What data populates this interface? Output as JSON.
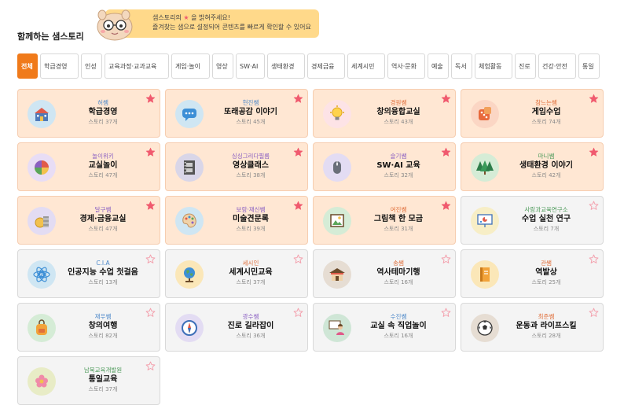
{
  "header": {
    "title": "함께하는 샘스토리",
    "notice_line1_a": "샘스토리의",
    "notice_line1_b": "을 밝혀주세요!",
    "notice_line2": "즐겨찾는 샘으로 설정되어 콘텐츠를 빠르게 확인할 수 있어요"
  },
  "filters": [
    {
      "label": "전체",
      "active": true,
      "w": 26
    },
    {
      "label": "학급경영",
      "w": 49
    },
    {
      "label": "인성",
      "w": 27
    },
    {
      "label": "교육과정·교과교육",
      "w": 82
    },
    {
      "label": "게임·놀이",
      "w": 49
    },
    {
      "label": "영상",
      "w": 27
    },
    {
      "label": "SW·AI",
      "w": 37
    },
    {
      "label": "생태환경",
      "w": 48
    },
    {
      "label": "경제금융",
      "w": 48
    },
    {
      "label": "세계시민",
      "w": 48
    },
    {
      "label": "역사·문화",
      "w": 48
    },
    {
      "label": "예술",
      "w": 27
    },
    {
      "label": "독서",
      "w": 27
    },
    {
      "label": "체험활동",
      "w": 48
    },
    {
      "label": "진로",
      "w": 27
    },
    {
      "label": "건강·안전",
      "w": 48
    },
    {
      "label": "통일",
      "w": 27
    }
  ],
  "colors": {
    "accent": "#f07a1a",
    "card_highlight": "#ffe7d3",
    "card_default": "#f4f4f4",
    "star_filled": "#f05a6e",
    "teacher_orange": "#e0703c",
    "teacher_blue": "#4d88c9",
    "teacher_green": "#4d9a5a"
  },
  "cards": [
    {
      "teacher": "허쌤",
      "title": "학급경영",
      "count": "스토리 37개",
      "hl": true,
      "fav": true,
      "tc": "#4d88c9",
      "bg": "#cfe6f3",
      "icon": "school-icon"
    },
    {
      "teacher": "현진쌤",
      "title": "또래공감 이야기",
      "count": "스토리 45개",
      "hl": true,
      "fav": true,
      "tc": "#4d88c9",
      "bg": "#cfe6f3",
      "icon": "chat-icon"
    },
    {
      "teacher": "경원쌤",
      "title": "창의융합교실",
      "count": "스토리 43개",
      "hl": true,
      "fav": true,
      "tc": "#e0703c",
      "bg": "#fde3e6",
      "icon": "lightbulb-icon"
    },
    {
      "teacher": "참느는쌤",
      "title": "게임수업",
      "count": "스토리 74개",
      "hl": true,
      "fav": true,
      "tc": "#e0703c",
      "bg": "#fbd6c4",
      "icon": "dice-icon"
    },
    {
      "teacher": "놀이위키",
      "title": "교실놀이",
      "count": "스토리 47개",
      "hl": true,
      "fav": true,
      "tc": "#8a5fc2",
      "bg": "#e8ddf5",
      "icon": "ball-icon"
    },
    {
      "teacher": "싱싱그리다필름",
      "title": "영상클래스",
      "count": "스토리 38개",
      "hl": true,
      "fav": true,
      "tc": "#8a5fc2",
      "bg": "#d9d6e8",
      "icon": "film-icon"
    },
    {
      "teacher": "슬기쌤",
      "title": "SW·AI 교육",
      "count": "스토리 32개",
      "hl": true,
      "fav": true,
      "tc": "#8a5fc2",
      "bg": "#e3dcf3",
      "icon": "mouse-icon"
    },
    {
      "teacher": "마니쌤",
      "title": "생태환경 이야기",
      "count": "스토리 42개",
      "hl": true,
      "fav": true,
      "tc": "#4d9a5a",
      "bg": "#d5ecd6",
      "icon": "tree-icon"
    },
    {
      "teacher": "달구쌤",
      "title": "경제·금융교실",
      "count": "스토리 47개",
      "hl": true,
      "fav": true,
      "tc": "#8a5fc2",
      "bg": "#e3dcf3",
      "icon": "coin-icon"
    },
    {
      "teacher": "보람·재신쌤",
      "title": "미술견문록",
      "count": "스토리 39개",
      "hl": true,
      "fav": true,
      "tc": "#8a5fc2",
      "bg": "#cfe6f3",
      "icon": "palette-icon"
    },
    {
      "teacher": "여진쌤",
      "title": "그림책 한 모금",
      "count": "스토리 31개",
      "hl": true,
      "fav": true,
      "tc": "#e0703c",
      "bg": "#d5ecd6",
      "icon": "picture-book-icon"
    },
    {
      "teacher": "사람과교육연구소",
      "title": "수업 실천 연구",
      "count": "스토리 7개",
      "hl": false,
      "fav": false,
      "tc": "#4d9a5a",
      "bg": "#f7eec6",
      "icon": "presentation-icon"
    },
    {
      "teacher": "C.I.A",
      "title": "인공지능 수업 첫걸음",
      "count": "스토리 13개",
      "hl": false,
      "fav": false,
      "tc": "#4d88c9",
      "bg": "#cfe6f3",
      "icon": "atom-ai-icon"
    },
    {
      "teacher": "세시인",
      "title": "세계시민교육",
      "count": "스토리 37개",
      "hl": false,
      "fav": false,
      "tc": "#e0703c",
      "bg": "#fbe7b8",
      "icon": "globe-icon"
    },
    {
      "teacher": "송쌤",
      "title": "역사테마기행",
      "count": "스토리 16개",
      "hl": false,
      "fav": false,
      "tc": "#e0703c",
      "bg": "#e6ddd3",
      "icon": "palace-icon"
    },
    {
      "teacher": "관쌤",
      "title": "역발상",
      "count": "스토리 25개",
      "hl": false,
      "fav": false,
      "tc": "#e0703c",
      "bg": "#fbe7b8",
      "icon": "book-icon"
    },
    {
      "teacher": "재우쌤",
      "title": "창의여행",
      "count": "스토리 82개",
      "hl": false,
      "fav": false,
      "tc": "#4d88c9",
      "bg": "#d5ecd6",
      "icon": "backpack-icon"
    },
    {
      "teacher": "광수쌤",
      "title": "진로 길라잡이",
      "count": "스토리 36개",
      "hl": false,
      "fav": false,
      "tc": "#8a5fc2",
      "bg": "#e3dcf3",
      "icon": "compass-icon"
    },
    {
      "teacher": "수진쌤",
      "title": "교실 속 직업놀이",
      "count": "스토리 16개",
      "hl": false,
      "fav": false,
      "tc": "#4d88c9",
      "bg": "#cfe6d6",
      "icon": "teacher-icon"
    },
    {
      "teacher": "최준쌤",
      "title": "운동과 라이프스킬",
      "count": "스토리 28개",
      "hl": false,
      "fav": false,
      "tc": "#e0703c",
      "bg": "#e6ddd3",
      "icon": "soccer-icon"
    },
    {
      "teacher": "남북교육개발원",
      "title": "통일교육",
      "count": "스토리 37개",
      "hl": false,
      "fav": false,
      "tc": "#4d9a5a",
      "bg": "#e8ecc6",
      "icon": "flower-icon"
    }
  ]
}
